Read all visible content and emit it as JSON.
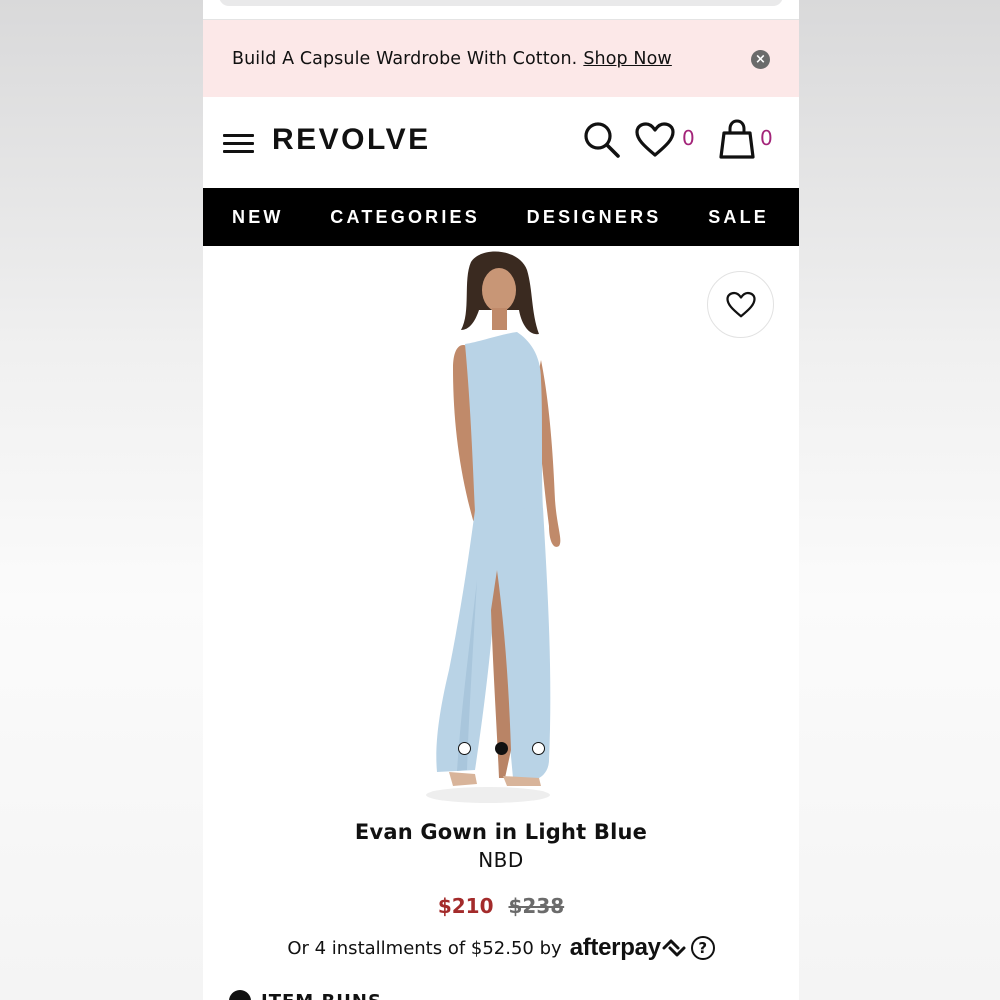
{
  "promo": {
    "text": "Build A Capsule Wardrobe With Cotton.",
    "link": "Shop Now",
    "close_glyph": "×"
  },
  "header": {
    "logo": "REVOLVE",
    "wishlist_count": "0",
    "cart_count": "0",
    "icons": [
      "menu-icon",
      "search-icon",
      "heart-icon",
      "shopping-bag-icon"
    ]
  },
  "nav": {
    "items": [
      "NEW",
      "CATEGORIES",
      "DESIGNERS",
      "SALE"
    ]
  },
  "product": {
    "title": "Evan Gown in Light Blue",
    "brand": "NBD",
    "sale_price": "$210",
    "original_price": "$238",
    "installments_text": "Or 4 installments of $52.50 by",
    "afterpay": "afterpay",
    "help_glyph": "?",
    "image_carousel": {
      "count": 3,
      "active_index": 1
    },
    "cut_off_text": "ITEM RUNS"
  },
  "colors": {
    "promo_bg": "#fce8e8",
    "nav_bg": "#000000",
    "badge_count": "#a32479",
    "sale_price": "#a32b2b",
    "dress": "#b9d3e6"
  }
}
